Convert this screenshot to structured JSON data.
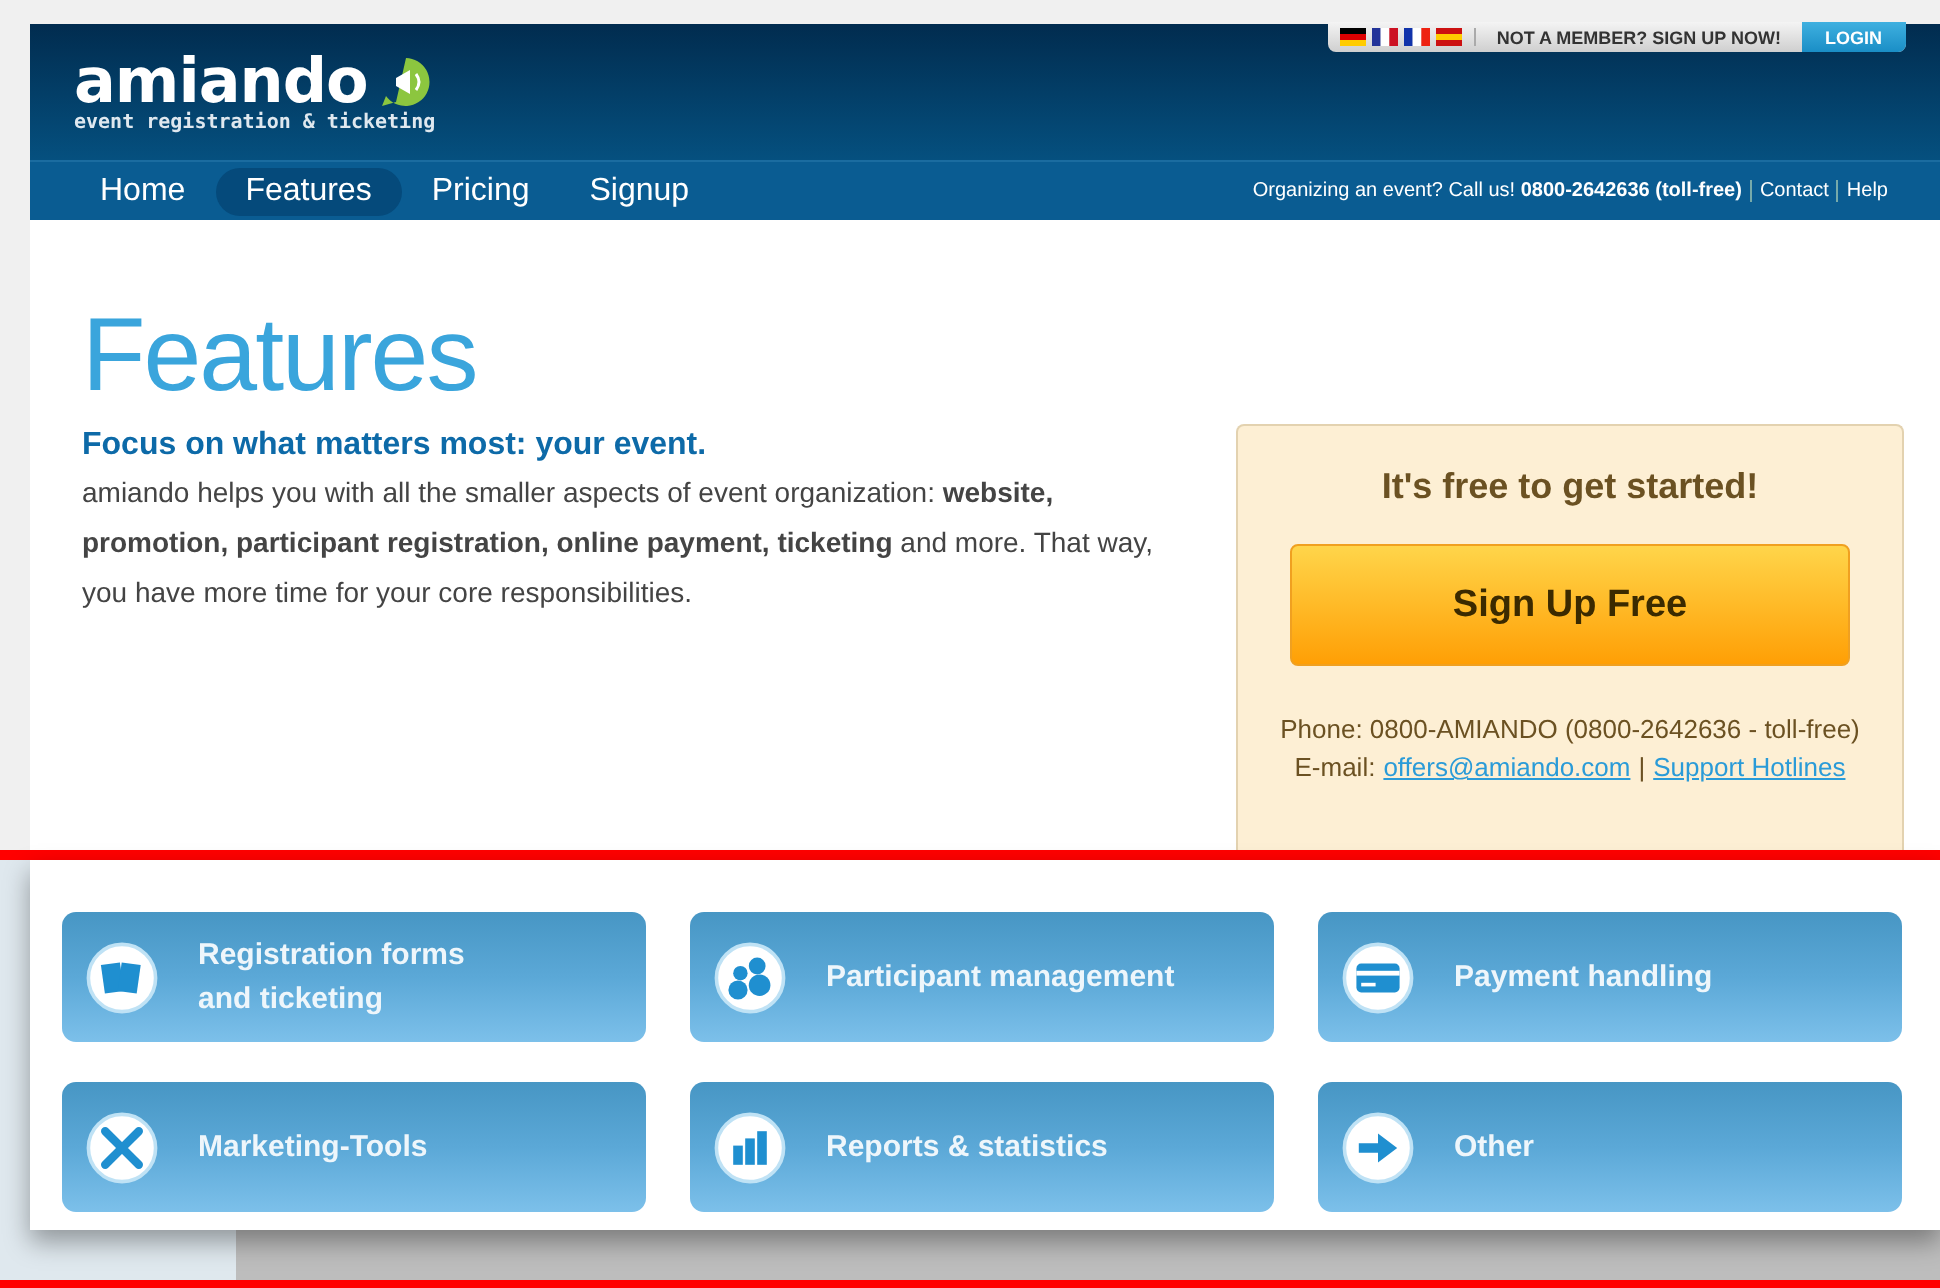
{
  "header": {
    "logo": "amiando",
    "tagline": "event registration & ticketing",
    "member_prompt": "NOT A MEMBER? SIGN UP NOW!",
    "login": "LOGIN"
  },
  "nav": [
    {
      "label": "Home",
      "selected": false
    },
    {
      "label": "Features",
      "selected": true
    },
    {
      "label": "Pricing",
      "selected": false
    },
    {
      "label": "Signup",
      "selected": false
    }
  ],
  "contact_bar": {
    "call": "Organizing an event? Call us! **0800-2642636 (toll-free)**",
    "links": [
      "Contact",
      "Help"
    ]
  },
  "main": {
    "title": "Features",
    "subtitle": "Focus on what matters most: your event.",
    "intro": "amiando helps you with all the smaller aspects of event organization: **website, promotion, participant registration, online payment, ticketing** and more. That way, you have more time for your core responsibilities."
  },
  "signup_box": {
    "heading": "It's free to get started!",
    "button": "Sign Up Free",
    "phone": "Phone: 0800-AMIANDO (0800-2642636 - toll-free)",
    "email_label": "E-mail:",
    "email": "offers@amiando.com",
    "separator": "|",
    "hotlines": "Support Hotlines"
  },
  "features": [
    {
      "label": "Registration forms and ticketing"
    },
    {
      "label": "Participant management"
    },
    {
      "label": "Payment handling"
    },
    {
      "label": "Marketing-Tools"
    },
    {
      "label": "Reports & statistics"
    },
    {
      "label": "Other"
    }
  ]
}
